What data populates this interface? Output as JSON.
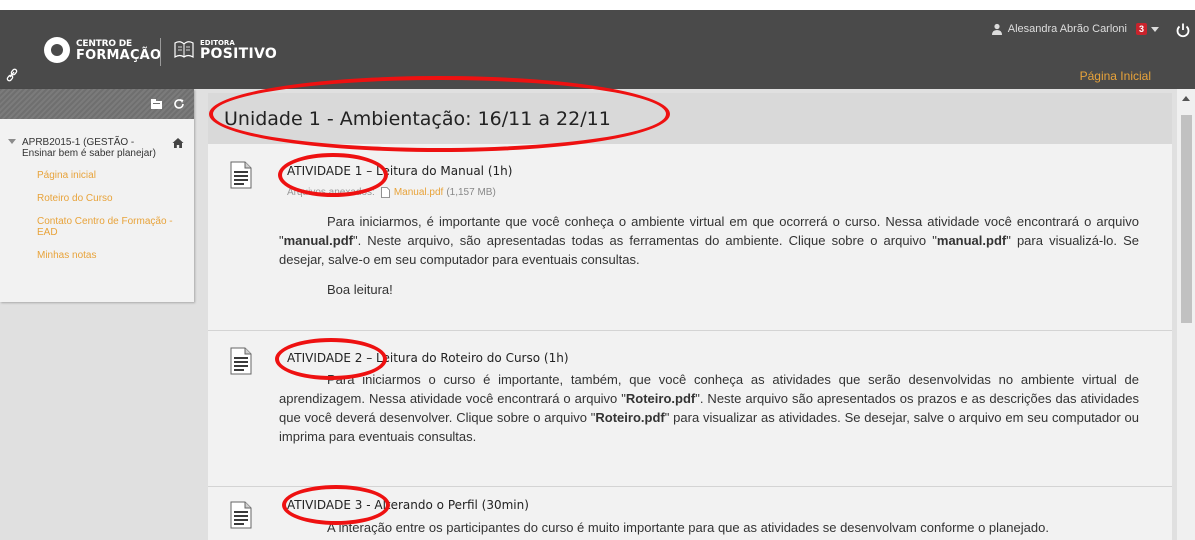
{
  "header": {
    "brand_cf_line1": "CENTRO DE",
    "brand_cf_line2": "FORMAÇÃO",
    "brand_ep_line1": "EDITORA",
    "brand_ep_line2": "POSITIVO",
    "user_name": "Alesandra Abrão Carloni",
    "notification_count": "3",
    "nav_home": "Página Inicial"
  },
  "sidebar": {
    "course_title": "APRB2015-1 (GESTÃO - Ensinar bem é saber planejar)",
    "links": [
      "Página inicial",
      "Roteiro do Curso",
      "Contato Centro de Formação - EAD",
      "Minhas notas"
    ]
  },
  "content": {
    "unit_title": "Unidade 1 - Ambientação: 16/11 a 22/11",
    "activities": [
      {
        "title": "ATIVIDADE 1 – Leitura do Manual (1h)",
        "attachments_label": "Arquivos anexados:",
        "file_name": "Manual.pdf",
        "file_size": "(1,157 MB)",
        "body_pre": "Para iniciarmos, é importante que você conheça o ambiente virtual em que ocorrerá o curso. Nessa atividade você encontrará o arquivo \"",
        "body_file1": "manual.pdf",
        "body_mid": "\". Neste arquivo, são apresentadas todas as ferramentas do ambiente. Clique sobre o arquivo \"",
        "body_file2": "manual.pdf",
        "body_post": "\" para visualizá-lo. Se desejar, salve-o em seu computador para eventuais consultas.",
        "closing": "Boa leitura!"
      },
      {
        "title": "ATIVIDADE 2 – Leitura do Roteiro do Curso (1h)",
        "body_pre": "Para iniciarmos o curso é importante, também, que você conheça as atividades que serão desenvolvidas no ambiente virtual de aprendizagem. Nessa atividade você encontrará o arquivo \"",
        "body_file1": "Roteiro.pdf",
        "body_mid": "\". Neste arquivo são apresentados os prazos e as descrições das atividades que você deverá desenvolver. Clique sobre o arquivo \"",
        "body_file2": "Roteiro.pdf",
        "body_post": "\" para visualizar as atividades. Se desejar, salve o arquivo em seu computador ou imprima para eventuais consultas."
      },
      {
        "title": "ATIVIDADE 3 - Alterando o Perfil (30min)",
        "body_pre": "A interação entre os participantes do curso é muito importante para que as atividades se desenvolvam conforme o planejado."
      }
    ]
  },
  "colors": {
    "header_bg": "#4a4a4a",
    "accent_orange": "#e8a33a",
    "annotation_red": "#ee1111",
    "badge_red": "#c9232c"
  },
  "icons": [
    "link-icon",
    "user-icon",
    "caret-down-icon",
    "power-icon",
    "folder-icon",
    "refresh-icon",
    "home-icon",
    "document-icon",
    "file-icon"
  ]
}
